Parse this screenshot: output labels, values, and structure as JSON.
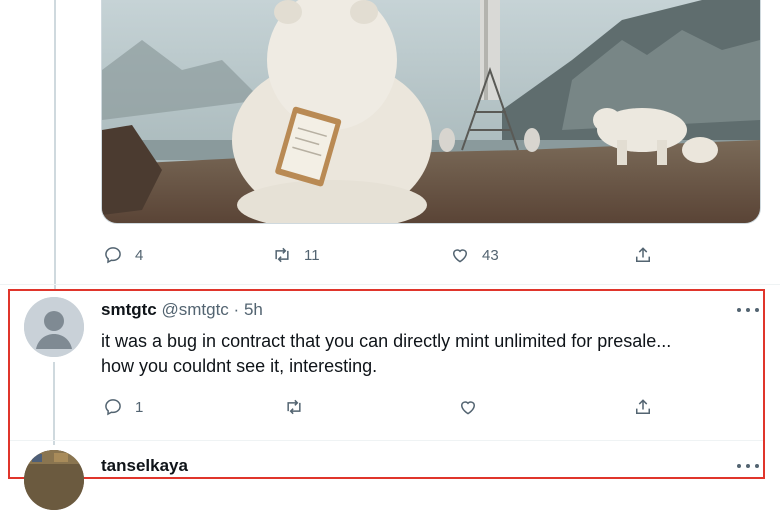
{
  "image_alt": "Polar bears in an arctic landscape",
  "top_tweet": {
    "actions": {
      "reply_count": "4",
      "retweet_count": "11",
      "like_count": "43"
    }
  },
  "reply": {
    "display_name": "smtgtc",
    "handle": "@smtgtc",
    "time": "5h",
    "separator": "·",
    "text_line1": "it was a bug in contract that you can directly mint unlimited for presale...",
    "text_line2": "how you couldnt see it, interesting.",
    "actions": {
      "reply_count": "1",
      "retweet_count": "",
      "like_count": ""
    }
  },
  "next_reply": {
    "display_name": "tanselkaya"
  },
  "colors": {
    "highlight_border": "#e0352b",
    "icon_gray": "#536471",
    "text": "#0f1419"
  }
}
